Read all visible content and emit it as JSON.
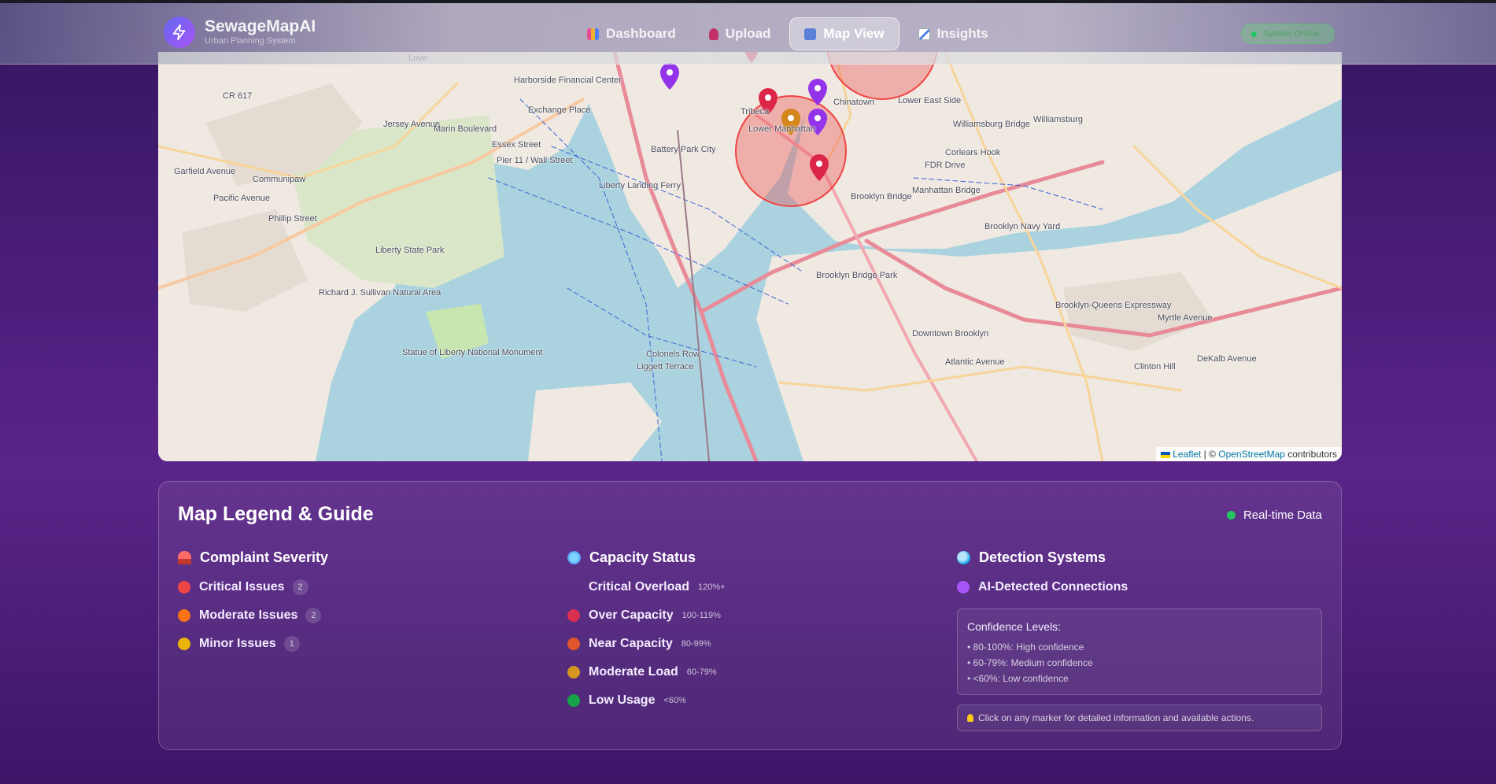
{
  "app": {
    "name": "SewageMapAI",
    "subtitle": "Urban Planning System",
    "status": "System Online"
  },
  "nav": [
    {
      "label": "Dashboard",
      "icon": "bar-chart-icon"
    },
    {
      "label": "Upload",
      "icon": "upload-icon"
    },
    {
      "label": "Map View",
      "icon": "map-icon",
      "active": true
    },
    {
      "label": "Insights",
      "icon": "trend-chart-icon"
    }
  ],
  "map": {
    "labels": [
      "Love",
      "Harborside Financial Center",
      "Exchange Place",
      "Jersey Avenue",
      "Marin Boulevard",
      "Essex Street",
      "CR 617",
      "Garfield Avenue",
      "Communipaw",
      "Pacific Avenue",
      "Phillip Street",
      "Liberty State Park",
      "Richard J. Sullivan Natural Area",
      "Statue of Liberty National Monument",
      "Battery Park City",
      "Tribeca",
      "Lower Manhattan",
      "Chinatown",
      "Lower East Side",
      "Williamsburg Bridge",
      "Williamsburg",
      "Corlears Hook",
      "FDR Drive",
      "Manhattan Bridge",
      "Brooklyn Bridge",
      "Brooklyn Navy Yard",
      "Downtown Brooklyn",
      "Brooklyn-Queens Expressway",
      "Atlantic Avenue",
      "Myrtle Avenue",
      "Clinton Hill",
      "DeKalb Avenue",
      "Colonels Row",
      "Liggett Terrace",
      "Pier 11 / Wall Street",
      "Brooklyn Bridge Park",
      "Liberty Landing Ferry"
    ],
    "attribution": {
      "leaflet": "Leaflet",
      "sep": " | © ",
      "osm": "OpenStreetMap",
      "suffix": " contributors"
    }
  },
  "legend": {
    "title": "Map Legend & Guide",
    "realtime": "Real-time Data",
    "severity": {
      "title": "Complaint Severity",
      "items": [
        {
          "label": "Critical Issues",
          "count": "2",
          "color": "#ef4444"
        },
        {
          "label": "Moderate Issues",
          "count": "2",
          "color": "#f97316"
        },
        {
          "label": "Minor Issues",
          "count": "1",
          "color": "#eab308"
        }
      ]
    },
    "capacity": {
      "title": "Capacity Status",
      "items": [
        {
          "label": "Critical Overload",
          "range": "120%+",
          "color": "transparent"
        },
        {
          "label": "Over Capacity",
          "range": "100-119%",
          "color": "#d9304f"
        },
        {
          "label": "Near Capacity",
          "range": "80-99%",
          "color": "#e0572b"
        },
        {
          "label": "Moderate Load",
          "range": "60-79%",
          "color": "#d4961f"
        },
        {
          "label": "Low Usage",
          "range": "<60%",
          "color": "#16a34a"
        }
      ]
    },
    "detection": {
      "title": "Detection Systems",
      "item": {
        "label": "AI-Detected Connections",
        "color": "#a855f7"
      },
      "confidence_title": "Confidence Levels:",
      "confidence": [
        "• 80-100%: High confidence",
        "• 60-79%: Medium confidence",
        "• <60%: Low confidence"
      ],
      "tip": "Click on any marker for detailed information and available actions."
    }
  }
}
